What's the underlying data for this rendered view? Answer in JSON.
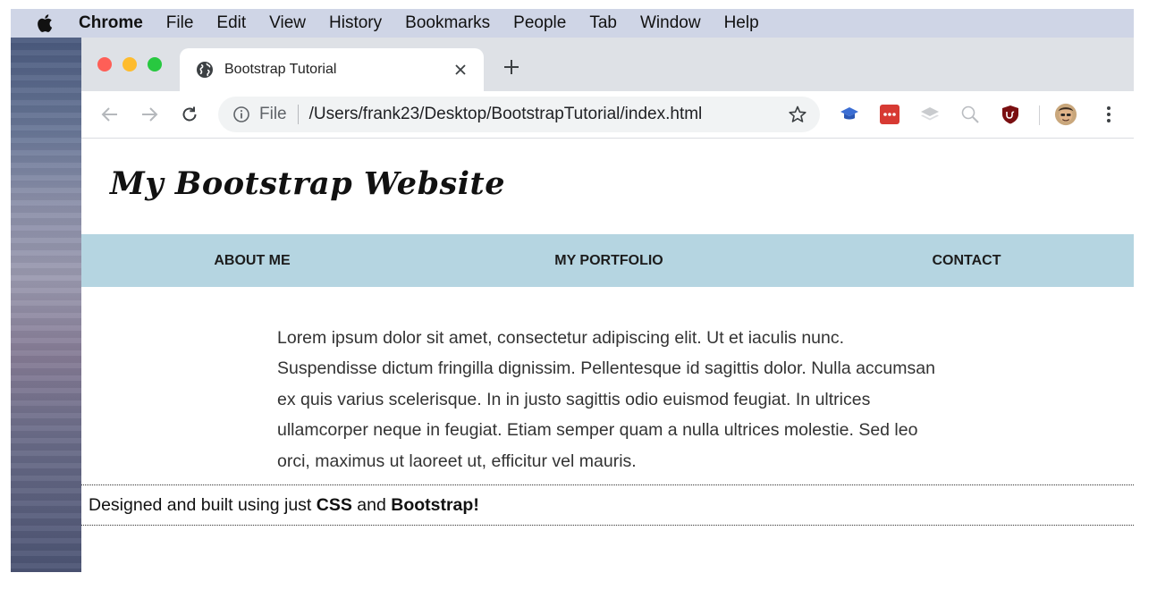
{
  "menubar": {
    "app_name": "Chrome",
    "items": [
      "File",
      "Edit",
      "View",
      "History",
      "Bookmarks",
      "People",
      "Tab",
      "Window",
      "Help"
    ]
  },
  "browser": {
    "tab": {
      "title": "Bootstrap Tutorial",
      "favicon": "globe-icon"
    },
    "address_bar": {
      "scheme_label": "File",
      "url": "/Users/frank23/Desktop/BootstrapTutorial/index.html"
    },
    "extensions": [
      "graduation-cap-icon",
      "more-dots-icon",
      "layers-icon",
      "magnifier-icon",
      "ublock-shield-icon",
      "profile-avatar"
    ]
  },
  "page": {
    "site_title": "My Bootstrap Website",
    "nav": [
      "ABOUT ME",
      "MY PORTFOLIO",
      "CONTACT"
    ],
    "intro": "Lorem ipsum dolor sit amet, consectetur adipiscing elit. Ut et iaculis nunc. Suspendisse dictum fringilla dignissim. Pellentesque id sagittis dolor. Nulla accumsan ex quis varius scelerisque. In in justo sagittis odio euismod feugiat. In ultrices ullamcorper neque in feugiat. Etiam semper quam a nulla ultrices molestie. Sed leo orci, maximus ut laoreet ut, efficitur vel mauris.",
    "footer": {
      "prefix": "Designed and built using just ",
      "tech1": "CSS",
      "middle": " and ",
      "tech2": "Bootstrap!"
    }
  },
  "colors": {
    "navbar_bg": "#b5d5e1",
    "menubar_bg": "#cfd5e6",
    "tabstrip_bg": "#dee1e6"
  }
}
